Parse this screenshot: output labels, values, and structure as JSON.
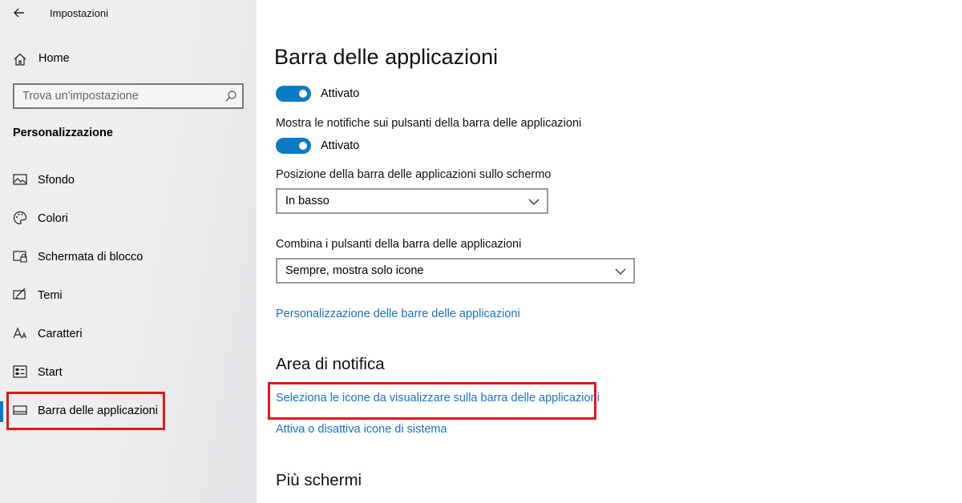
{
  "window": {
    "title": "Impostazioni"
  },
  "sidebar": {
    "home_label": "Home",
    "search_placeholder": "Trova un'impostazione",
    "section_title": "Personalizzazione",
    "items": [
      {
        "label": "Sfondo",
        "icon": "picture-icon"
      },
      {
        "label": "Colori",
        "icon": "palette-icon"
      },
      {
        "label": "Schermata di blocco",
        "icon": "lock-screen-icon"
      },
      {
        "label": "Temi",
        "icon": "themes-icon"
      },
      {
        "label": "Caratteri",
        "icon": "fonts-icon"
      },
      {
        "label": "Start",
        "icon": "start-icon"
      },
      {
        "label": "Barra delle applicazioni",
        "icon": "taskbar-icon",
        "selected": true
      }
    ]
  },
  "main": {
    "title": "Barra delle applicazioni",
    "toggle1_state": "Attivato",
    "notify_label": "Mostra le notifiche sui pulsanti della barra delle applicazioni",
    "toggle2_state": "Attivato",
    "position_label": "Posizione della barra delle applicazioni sullo schermo",
    "position_value": "In basso",
    "combine_label": "Combina i pulsanti della barra delle applicazioni",
    "combine_value": "Sempre, mostra solo icone",
    "customize_link": "Personalizzazione delle barre delle applicazioni",
    "notify_area_heading": "Area di notifica",
    "select_icons_link": "Seleziona le icone da visualizzare sulla barra delle applicazioni",
    "system_icons_link": "Attiva o disattiva icone di sistema",
    "multi_screen_heading": "Più schermi"
  },
  "colors": {
    "accent": "#0a7bc4",
    "link": "#1a73c8",
    "highlight": "#e41616"
  }
}
